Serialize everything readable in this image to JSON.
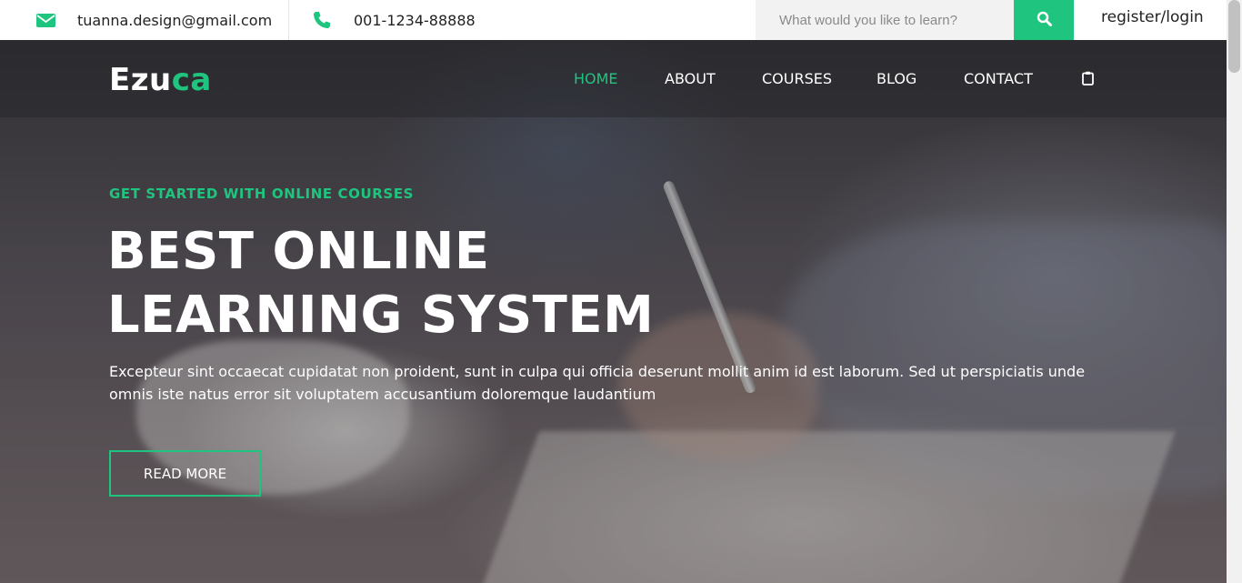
{
  "topbar": {
    "email": "tuanna.design@gmail.com",
    "phone": "001-1234-88888",
    "search_placeholder": "What would you like to learn?",
    "login": "register/login",
    "icons": {
      "email": "envelope-icon",
      "phone": "phone-icon",
      "search": "search-icon"
    }
  },
  "brand": {
    "part1": "Ezu",
    "part2": "ca"
  },
  "nav": {
    "items": [
      {
        "label": "HOME"
      },
      {
        "label": "ABOUT"
      },
      {
        "label": "COURSES"
      },
      {
        "label": "BLOG"
      },
      {
        "label": "CONTACT"
      }
    ],
    "cart_icon": "clipboard-icon"
  },
  "hero": {
    "kicker": "GET STARTED WITH ONLINE COURSES",
    "title_line1": "BEST ONLINE",
    "title_line2": "LEARNING SYSTEM",
    "description": "Excepteur sint occaecat cupidatat non proident, sunt in culpa qui officia deserunt mollit anim id est laborum. Sed ut perspiciatis unde omnis iste natus error sit voluptatem accusantium doloremque laudantium",
    "button": "READ MORE"
  },
  "colors": {
    "accent": "#1fc57f",
    "text": "#222222"
  }
}
